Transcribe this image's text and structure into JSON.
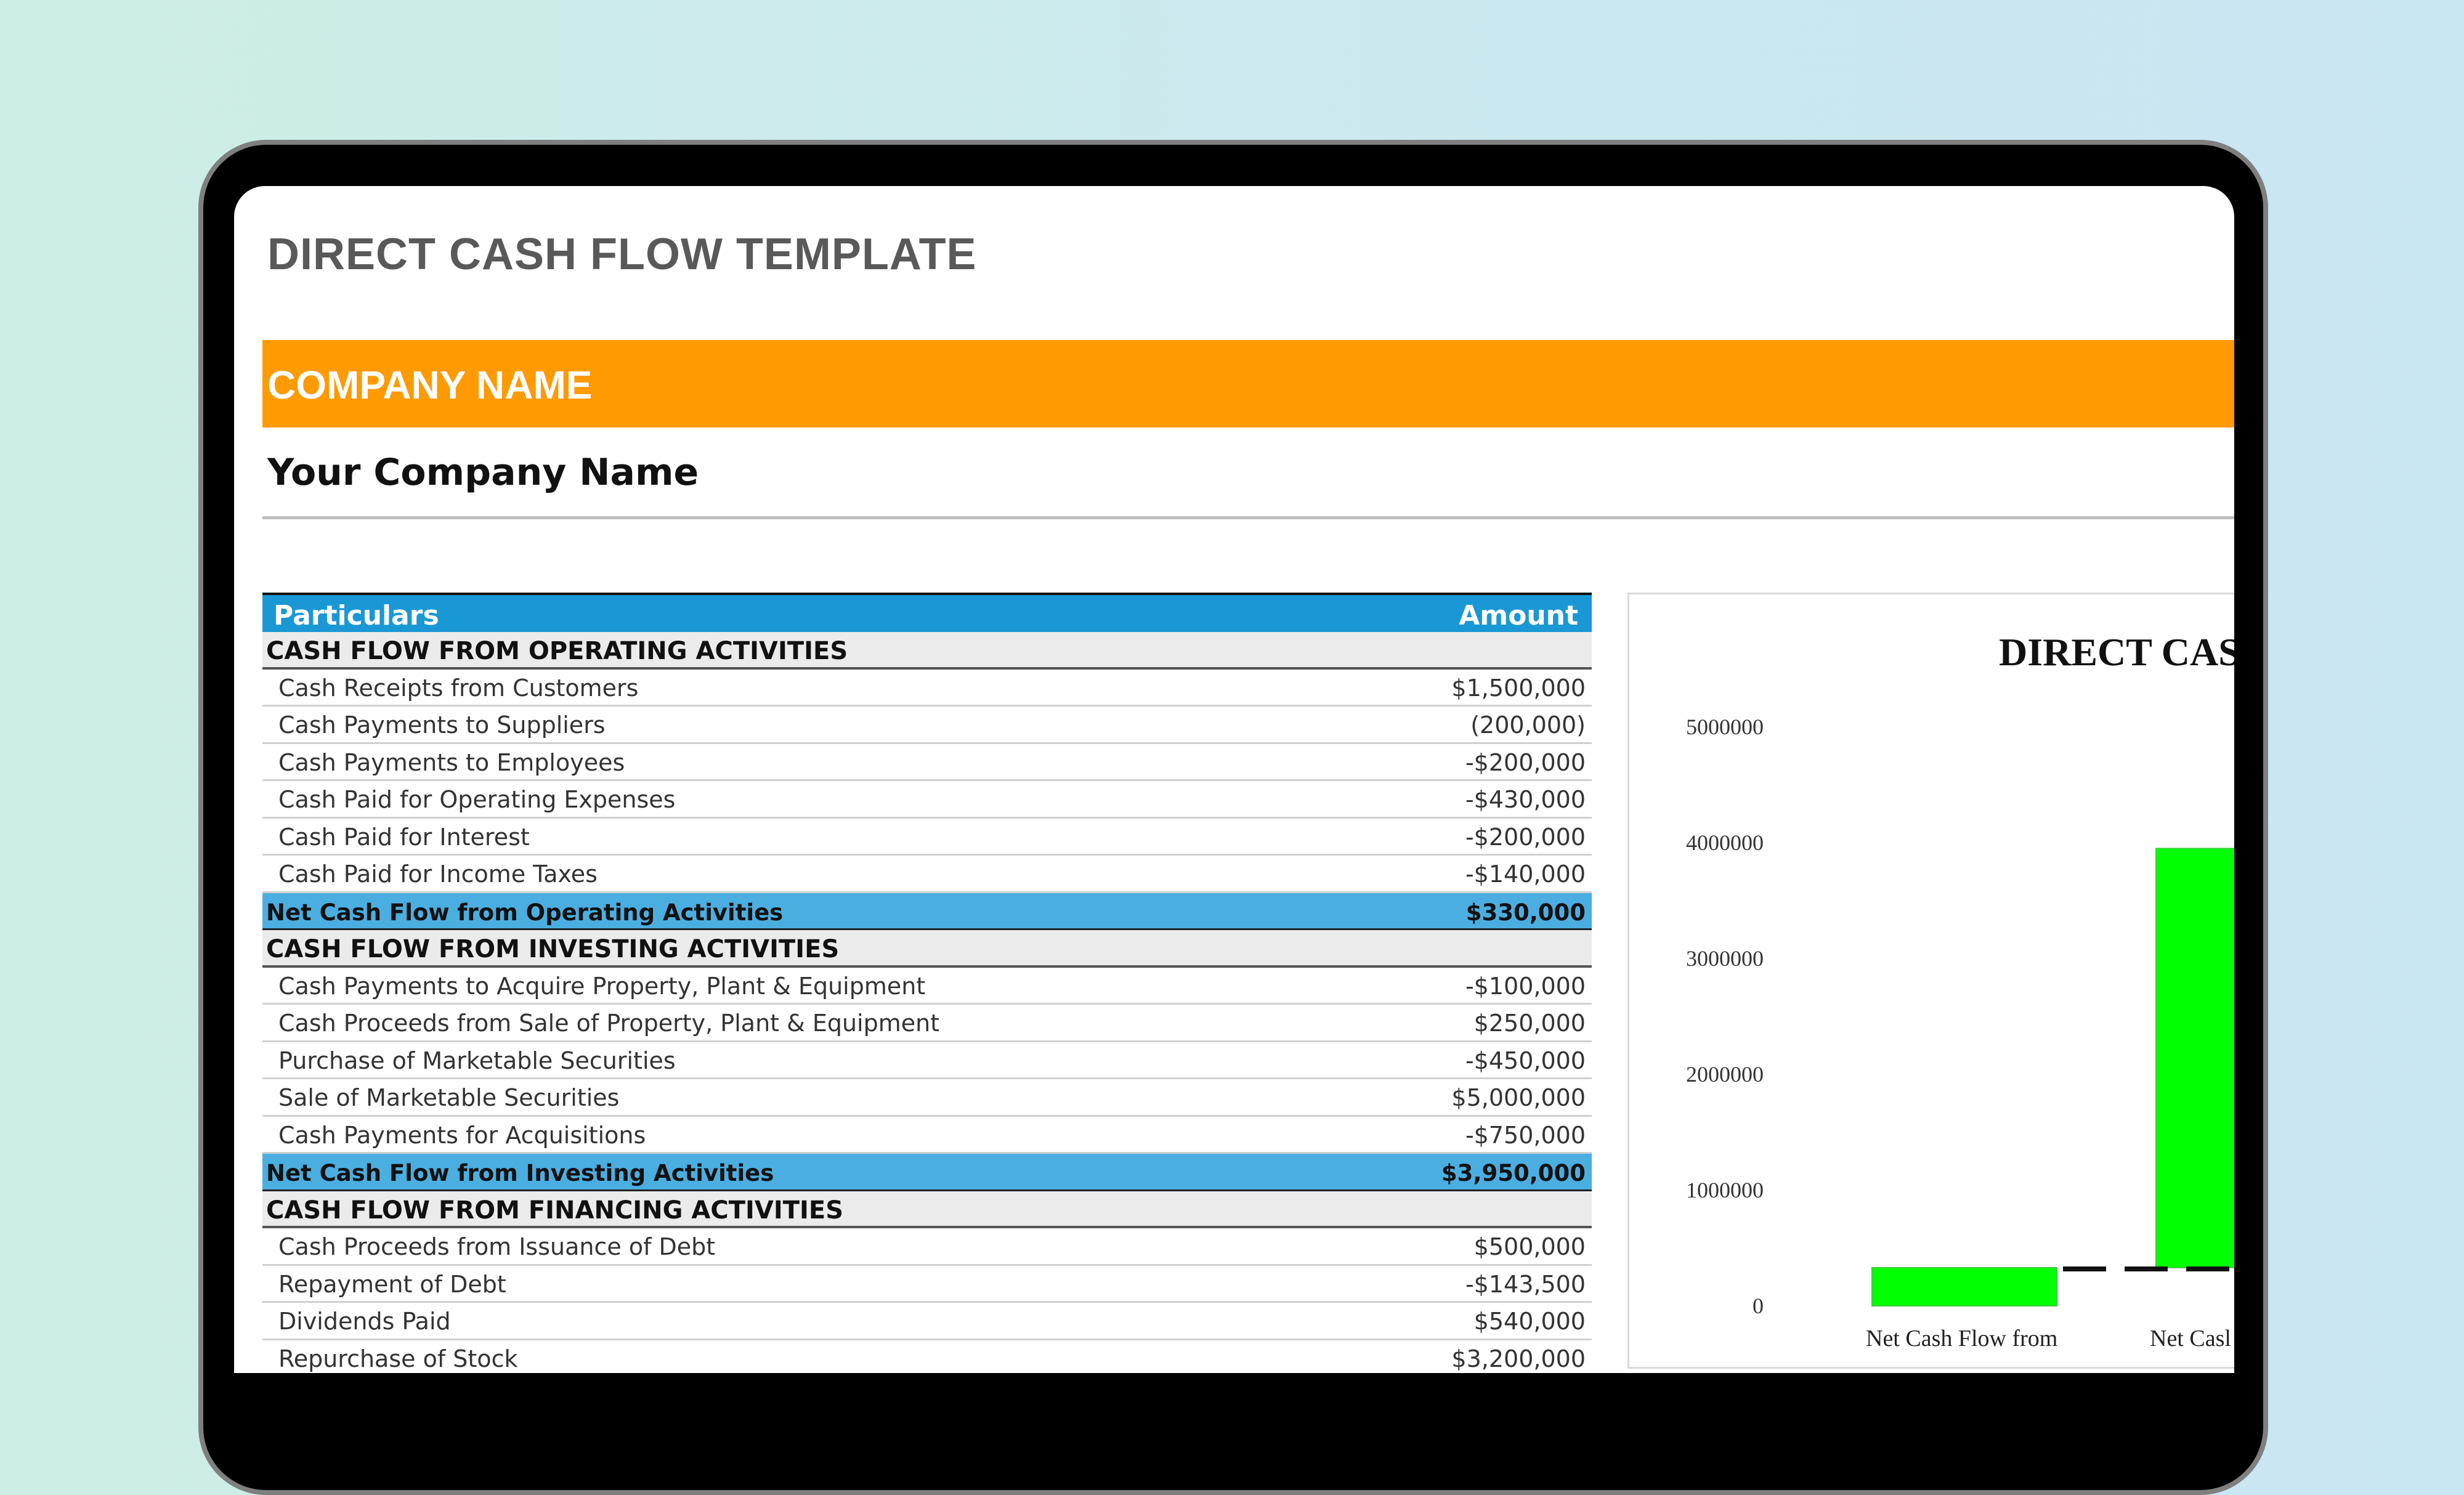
{
  "document": {
    "title": "DIRECT CASH FLOW TEMPLATE",
    "company_header": "COMPANY NAME",
    "company_name": "Your Company Name"
  },
  "table": {
    "header": {
      "label": "Particulars",
      "amount": "Amount"
    },
    "rows": [
      {
        "kind": "section",
        "label": "CASH FLOW FROM OPERATING ACTIVITIES",
        "value": ""
      },
      {
        "kind": "item",
        "label": "Cash Receipts from Customers",
        "value": "$1,500,000"
      },
      {
        "kind": "item",
        "label": "Cash Payments to Suppliers",
        "value": "(200,000)"
      },
      {
        "kind": "item",
        "label": "Cash Payments to Employees",
        "value": "-$200,000"
      },
      {
        "kind": "item",
        "label": "Cash Paid for Operating Expenses",
        "value": "-$430,000"
      },
      {
        "kind": "item",
        "label": "Cash Paid for Interest",
        "value": "-$200,000"
      },
      {
        "kind": "item",
        "label": "Cash Paid for Income Taxes",
        "value": "-$140,000"
      },
      {
        "kind": "total",
        "label": "Net Cash Flow from Operating Activities",
        "value": "$330,000"
      },
      {
        "kind": "section",
        "label": "CASH FLOW FROM INVESTING ACTIVITIES",
        "value": ""
      },
      {
        "kind": "item",
        "label": "Cash Payments to Acquire Property, Plant & Equipment",
        "value": "-$100,000"
      },
      {
        "kind": "item",
        "label": "Cash Proceeds from Sale of Property, Plant & Equipment",
        "value": "$250,000"
      },
      {
        "kind": "item",
        "label": "Purchase of Marketable Securities",
        "value": "-$450,000"
      },
      {
        "kind": "item",
        "label": "Sale of Marketable Securities",
        "value": "$5,000,000"
      },
      {
        "kind": "item",
        "label": "Cash Payments for Acquisitions",
        "value": "-$750,000"
      },
      {
        "kind": "total",
        "label": "Net Cash Flow from Investing Activities",
        "value": "$3,950,000"
      },
      {
        "kind": "section",
        "label": "CASH FLOW FROM FINANCING ACTIVITIES",
        "value": ""
      },
      {
        "kind": "item",
        "label": "Cash Proceeds from Issuance of Debt",
        "value": "$500,000"
      },
      {
        "kind": "item",
        "label": "Repayment of Debt",
        "value": "-$143,500"
      },
      {
        "kind": "item",
        "label": "Dividends Paid",
        "value": "$540,000"
      },
      {
        "kind": "item",
        "label": "Repurchase of Stock",
        "value": "$3,200,000"
      }
    ]
  },
  "chart_data": {
    "type": "bar",
    "title": "DIRECT CAS",
    "categories": [
      "Net Cash Flow from",
      "Net Casl"
    ],
    "base_values": [
      330000,
      330000
    ],
    "values": [
      330000,
      3950000
    ],
    "yticks": [
      0,
      1000000,
      2000000,
      3000000,
      4000000,
      5000000
    ],
    "ylim": [
      0,
      5000000
    ],
    "bar_color": "#00ff00",
    "connector": "dashed"
  }
}
